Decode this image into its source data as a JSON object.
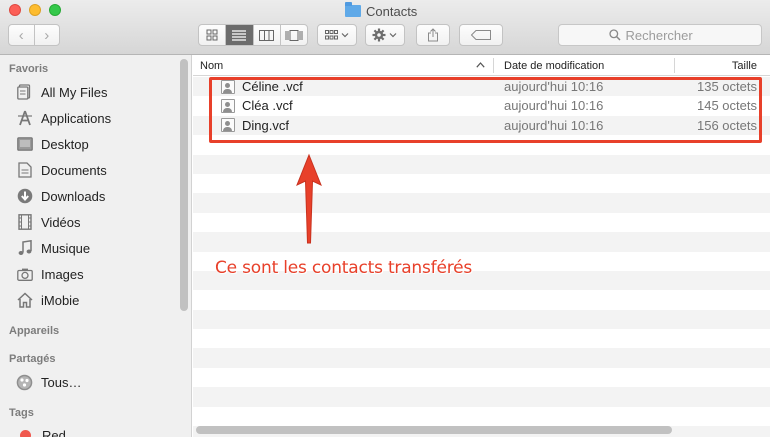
{
  "window": {
    "title": "Contacts"
  },
  "toolbar": {
    "back_icon": "‹",
    "forward_icon": "›",
    "search_placeholder": "Rechercher"
  },
  "sidebar": {
    "sections": {
      "favoris": "Favoris",
      "appareils": "Appareils",
      "partages": "Partagés",
      "tags": "Tags"
    },
    "favorites": [
      {
        "label": "All My Files",
        "icon": "all-files-icon"
      },
      {
        "label": "Applications",
        "icon": "applications-icon"
      },
      {
        "label": "Desktop",
        "icon": "desktop-icon"
      },
      {
        "label": "Documents",
        "icon": "documents-icon"
      },
      {
        "label": "Downloads",
        "icon": "downloads-icon"
      },
      {
        "label": "Vidéos",
        "icon": "videos-icon"
      },
      {
        "label": "Musique",
        "icon": "music-icon"
      },
      {
        "label": "Images",
        "icon": "images-icon"
      },
      {
        "label": "iMobie",
        "icon": "home-icon"
      }
    ],
    "shared": [
      {
        "label": "Tous…",
        "icon": "network-icon"
      }
    ],
    "tags": [
      {
        "label": "Red",
        "color": "#f0584e"
      }
    ]
  },
  "list": {
    "columns": {
      "name": "Nom",
      "date": "Date de modification",
      "size": "Taille"
    },
    "files": [
      {
        "name": "Céline .vcf",
        "date": "aujourd'hui 10:16",
        "size": "135 octets"
      },
      {
        "name": "Cléa .vcf",
        "date": "aujourd'hui 10:16",
        "size": "145 octets"
      },
      {
        "name": "Ding.vcf",
        "date": "aujourd'hui 10:16",
        "size": "156 octets"
      }
    ]
  },
  "annotation": {
    "text": "Ce sont les contacts transférés",
    "color": "#e8402a"
  }
}
